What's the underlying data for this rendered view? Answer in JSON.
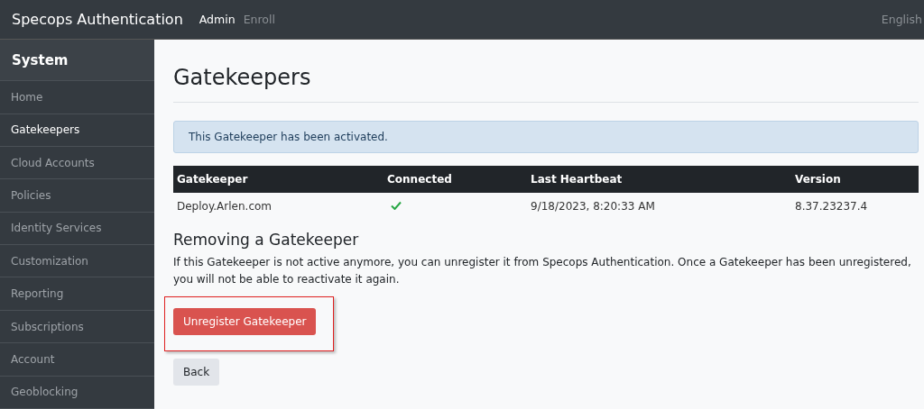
{
  "navbar": {
    "brand": "Specops Authentication",
    "links": [
      {
        "label": "Admin",
        "selected": true
      },
      {
        "label": "Enroll",
        "selected": false
      }
    ],
    "language": "English"
  },
  "sidebar": {
    "title": "System",
    "items": [
      {
        "label": "Home",
        "selected": false
      },
      {
        "label": "Gatekeepers",
        "selected": true
      },
      {
        "label": "Cloud Accounts",
        "selected": false
      },
      {
        "label": "Policies",
        "selected": false
      },
      {
        "label": "Identity Services",
        "selected": false
      },
      {
        "label": "Customization",
        "selected": false
      },
      {
        "label": "Reporting",
        "selected": false
      },
      {
        "label": "Subscriptions",
        "selected": false
      },
      {
        "label": "Account",
        "selected": false
      },
      {
        "label": "Geoblocking",
        "selected": false
      }
    ]
  },
  "page": {
    "title": "Gatekeepers",
    "alert": "This Gatekeeper has been activated.",
    "table": {
      "columns": [
        "Gatekeeper",
        "Connected",
        "Last Heartbeat",
        "Version"
      ],
      "rows": [
        {
          "gatekeeper": "Deploy.Arlen.com",
          "connected": true,
          "last_heartbeat": "9/18/2023, 8:20:33 AM",
          "version": "8.37.23237.4"
        }
      ]
    },
    "section_title": "Removing a Gatekeeper",
    "section_text": "If this Gatekeeper is not active anymore, you can unregister it from Specops Authentication. Once a Gatekeeper has been unregistered, you will not be able to reactivate it again.",
    "unregister_button": {
      "label": "Unregister Gatekeeper",
      "highlighted": true
    },
    "back_button": {
      "label": "Back"
    }
  }
}
